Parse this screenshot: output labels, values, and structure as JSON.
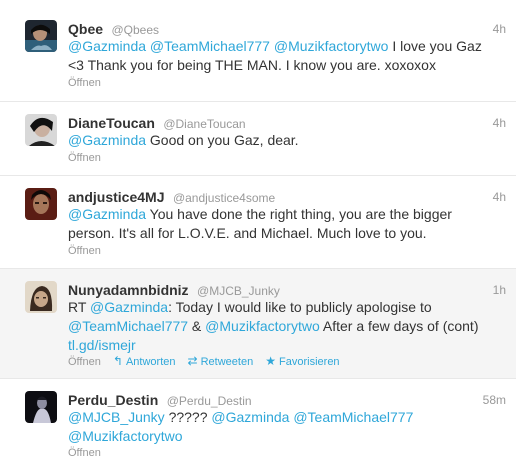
{
  "labels": {
    "open": "Öffnen",
    "reply": "Antworten",
    "retweet": "Retweeten",
    "favorite": "Favorisieren"
  },
  "tweets": [
    {
      "fullname": "Qbee",
      "username": "@Qbees",
      "time": "4h",
      "segments": [
        {
          "t": "mention",
          "v": "@Gazminda"
        },
        {
          "t": "text",
          "v": " "
        },
        {
          "t": "mention",
          "v": "@TeamMichael777"
        },
        {
          "t": "text",
          "v": " "
        },
        {
          "t": "mention",
          "v": "@Muzikfactorytwo"
        },
        {
          "t": "text",
          "v": " I love you Gaz <3 Thank you for being THE MAN. I know you are. xoxoxox"
        }
      ]
    },
    {
      "fullname": "DianeToucan",
      "username": "@DianeToucan",
      "time": "4h",
      "segments": [
        {
          "t": "mention",
          "v": "@Gazminda"
        },
        {
          "t": "text",
          "v": " Good on you Gaz, dear."
        }
      ]
    },
    {
      "fullname": "andjustice4MJ",
      "username": "@andjustice4some",
      "time": "4h",
      "segments": [
        {
          "t": "mention",
          "v": "@Gazminda"
        },
        {
          "t": "text",
          "v": " You have done the right thing, you are the bigger person. It's all for L.O.V.E. and Michael. Much love to you."
        }
      ]
    },
    {
      "fullname": "Nunyadamnbidniz",
      "username": "@MJCB_Junky",
      "time": "1h",
      "segments": [
        {
          "t": "text",
          "v": "RT "
        },
        {
          "t": "mention",
          "v": "@Gazminda"
        },
        {
          "t": "text",
          "v": ": Today I would like to publicly apologise to "
        },
        {
          "t": "mention",
          "v": "@TeamMichael777"
        },
        {
          "t": "text",
          "v": " & "
        },
        {
          "t": "mention",
          "v": "@Muzikfactorytwo"
        },
        {
          "t": "text",
          "v": " After a few days of (cont) "
        },
        {
          "t": "link",
          "v": "tl.gd/ismejr"
        }
      ]
    },
    {
      "fullname": "Perdu_Destin",
      "username": "@Perdu_Destin",
      "time": "58m",
      "segments": [
        {
          "t": "mention",
          "v": "@MJCB_Junky"
        },
        {
          "t": "text",
          "v": " ????? "
        },
        {
          "t": "mention",
          "v": "@Gazminda"
        },
        {
          "t": "text",
          "v": " "
        },
        {
          "t": "mention",
          "v": "@TeamMichael777"
        },
        {
          "t": "text",
          "v": " "
        },
        {
          "t": "mention",
          "v": "@Muzikfactorytwo"
        }
      ]
    }
  ]
}
